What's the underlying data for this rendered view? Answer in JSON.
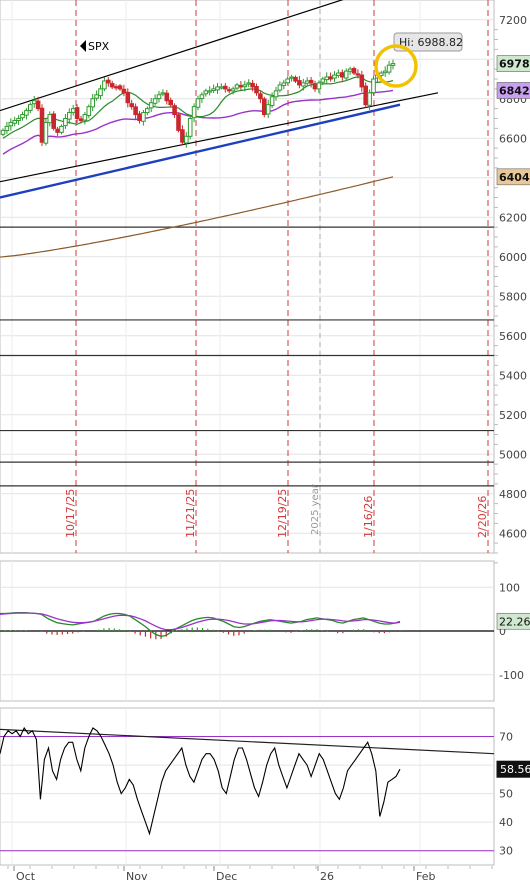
{
  "symbol": "SPX",
  "hi_label": "Hi: 6988.82",
  "price_tags": [
    {
      "text": "6978.0",
      "value": 6978,
      "color": "#cfe8cf"
    },
    {
      "text": "6842.0",
      "value": 6842,
      "color": "#c8a0f0"
    },
    {
      "text": "6404.7",
      "value": 6404.7,
      "color": "#e8c898"
    }
  ],
  "macd_tag": {
    "text": "22.267",
    "value": 22.267
  },
  "rsi_tag": {
    "text": "58.56",
    "value": 58.56
  },
  "month_labels": [
    "Oct",
    "Nov",
    "Dec",
    "26",
    "Feb"
  ],
  "date_markers": [
    "10/17/25",
    "11/21/25",
    "12/19/25",
    "1/16/26",
    "2/20/26"
  ],
  "year_label": "2025 year",
  "colors": {
    "up": "#2f9a2f",
    "down": "#c8282d",
    "sma_short": "#2a8a2a",
    "sma_mid": "#9933cc",
    "sma_long": "#8b5a2b",
    "channel": "#000000",
    "regression": "#1e3fbf",
    "highlight": "#f2c200",
    "marker_line": "#d23a3a"
  },
  "chart_data": [
    {
      "type": "candlestick",
      "title": "SPX",
      "ylim": [
        4500,
        7300
      ],
      "y_ticks": [
        4600,
        4800,
        5000,
        5200,
        5400,
        5600,
        5800,
        6000,
        6200,
        6400,
        6600,
        6800,
        7000,
        7200
      ],
      "x_labels": [
        "Oct",
        "Nov",
        "Dec",
        "26",
        "Feb"
      ],
      "close": [
        6640,
        6660,
        6680,
        6690,
        6700,
        6720,
        6740,
        6770,
        6790,
        6750,
        6580,
        6680,
        6720,
        6650,
        6630,
        6660,
        6700,
        6730,
        6750,
        6700,
        6690,
        6720,
        6760,
        6800,
        6820,
        6850,
        6890,
        6880,
        6860,
        6860,
        6850,
        6830,
        6780,
        6760,
        6720,
        6690,
        6730,
        6750,
        6780,
        6800,
        6820,
        6830,
        6790,
        6770,
        6720,
        6640,
        6580,
        6610,
        6700,
        6760,
        6800,
        6820,
        6840,
        6840,
        6850,
        6860,
        6860,
        6850,
        6840,
        6850,
        6870,
        6860,
        6870,
        6880,
        6860,
        6830,
        6800,
        6720,
        6770,
        6810,
        6840,
        6870,
        6880,
        6900,
        6910,
        6890,
        6870,
        6880,
        6890,
        6880,
        6850,
        6880,
        6900,
        6910,
        6900,
        6920,
        6930,
        6910,
        6940,
        6950,
        6930,
        6920,
        6860,
        6770,
        6830,
        6900,
        6920,
        6930,
        6940,
        6970,
        6978
      ],
      "horizontal_levels": [
        4840,
        4960,
        5120,
        5500,
        5680,
        6150
      ],
      "hi": 6988.82
    },
    {
      "type": "line",
      "title": "MACD",
      "ylim": [
        -160,
        160
      ],
      "y_ticks": [
        100,
        0,
        -100
      ],
      "series": [
        {
          "values": [
            40,
            40,
            41,
            42,
            42,
            42,
            41,
            40,
            38,
            30,
            24,
            19,
            17,
            15,
            14,
            16,
            18,
            20,
            22,
            28,
            34,
            38,
            40,
            40,
            38,
            34,
            26,
            18,
            10,
            0,
            -8,
            -12,
            -10,
            -2,
            6,
            12,
            18,
            24,
            28,
            30,
            31,
            30,
            26,
            22,
            16,
            10,
            8,
            10,
            14,
            18,
            22,
            24,
            26,
            24,
            22,
            20,
            18,
            20,
            22,
            26,
            28,
            30,
            28,
            26,
            24,
            20,
            18,
            22,
            26,
            28,
            30,
            26,
            22,
            18,
            16,
            16,
            18,
            22
          ]
        },
        {
          "values": [
            38,
            39,
            40,
            41,
            41,
            41,
            41,
            40,
            39,
            36,
            32,
            28,
            25,
            22,
            20,
            19,
            19,
            20,
            22,
            25,
            28,
            31,
            34,
            36,
            36,
            35,
            32,
            28,
            23,
            17,
            11,
            6,
            3,
            3,
            5,
            8,
            12,
            16,
            20,
            23,
            26,
            27,
            27,
            26,
            24,
            21,
            18,
            16,
            16,
            17,
            19,
            21,
            23,
            24,
            24,
            23,
            22,
            21,
            21,
            22,
            24,
            26,
            27,
            27,
            26,
            25,
            23,
            22,
            23,
            24,
            26,
            26,
            25,
            23,
            21,
            19,
            18,
            20
          ]
        }
      ],
      "histogram": [
        2,
        1,
        1,
        1,
        1,
        1,
        0,
        0,
        -1,
        -6,
        -8,
        -9,
        -8,
        -7,
        -6,
        -3,
        -1,
        0,
        0,
        3,
        6,
        7,
        6,
        4,
        2,
        -1,
        -6,
        -10,
        -13,
        -17,
        -19,
        -18,
        -13,
        -5,
        1,
        4,
        6,
        8,
        8,
        7,
        5,
        3,
        -1,
        -4,
        -8,
        -11,
        -10,
        -6,
        -2,
        1,
        3,
        3,
        3,
        0,
        -2,
        -3,
        -4,
        -1,
        1,
        4,
        4,
        4,
        1,
        -1,
        -2,
        -5,
        -5,
        0,
        3,
        4,
        4,
        0,
        -3,
        -5,
        -5,
        -3,
        0,
        2
      ]
    },
    {
      "type": "line",
      "title": "RSI",
      "ylim": [
        25,
        80
      ],
      "y_ticks": [
        70,
        60,
        50,
        40,
        30
      ],
      "reference_lines": [
        70,
        30
      ],
      "values": [
        64,
        70,
        72,
        71,
        72,
        70,
        73,
        71,
        72,
        69,
        48,
        62,
        66,
        58,
        55,
        62,
        66,
        68,
        68,
        62,
        58,
        66,
        70,
        73,
        72,
        70,
        67,
        64,
        60,
        54,
        50,
        52,
        55,
        53,
        48,
        44,
        40,
        36,
        42,
        48,
        54,
        58,
        60,
        62,
        64,
        66,
        60,
        56,
        54,
        58,
        62,
        64,
        64,
        62,
        58,
        52,
        50,
        56,
        62,
        66,
        66,
        62,
        57,
        52,
        49,
        54,
        60,
        64,
        66,
        60,
        56,
        52,
        56,
        60,
        64,
        62,
        60,
        56,
        60,
        64,
        62,
        58,
        54,
        50,
        48,
        52,
        58,
        60,
        62,
        64,
        66,
        68,
        64,
        58,
        42,
        47,
        54,
        55,
        56,
        58.56
      ]
    }
  ]
}
